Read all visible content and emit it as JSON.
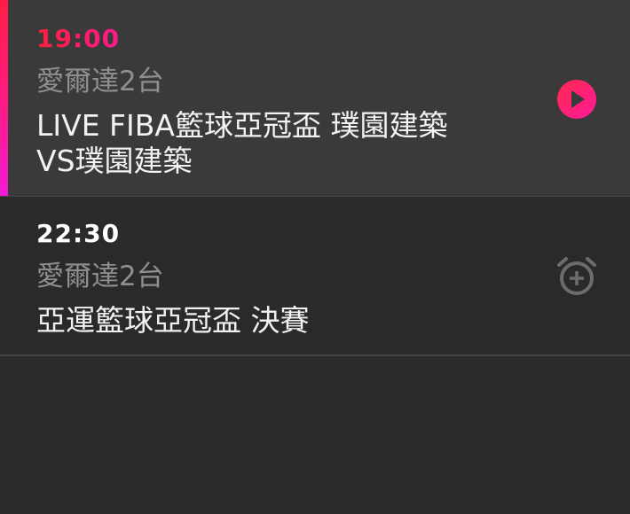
{
  "program_list": {
    "items": [
      {
        "time": "19:00",
        "channel": "愛爾達2台",
        "title_line1": "LIVE FIBA籃球亞冠盃 璞園建築",
        "title_line2": "VS璞園建築",
        "state": "live",
        "action_icon": "play-icon"
      },
      {
        "time": "22:30",
        "channel": "愛爾達2台",
        "title_line1": "亞運籃球亞冠盃 決賽",
        "state": "upcoming",
        "action_icon": "alarm-add-icon"
      }
    ]
  },
  "colors": {
    "live_accent_start": "#ff1d44",
    "live_accent_end": "#f31bd6",
    "active_row_bg": "#3a3a3a",
    "list_bg": "#2a2a2a",
    "channel_text": "#8f8f8f",
    "title_text": "#f2f2f2"
  }
}
